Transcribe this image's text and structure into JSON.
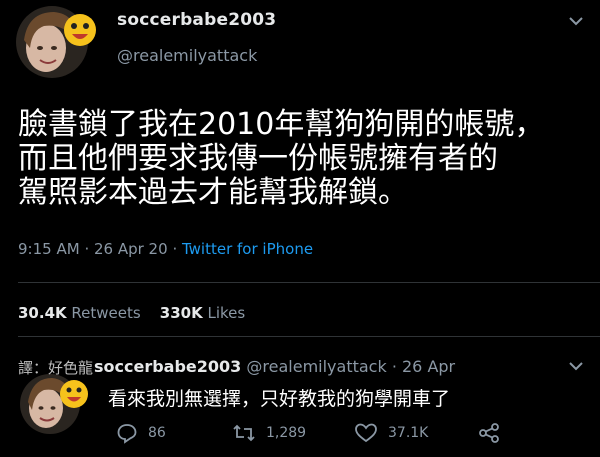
{
  "tweet": {
    "name": "soccerbabe2003",
    "handle": "@realemilyattack",
    "body_lines": [
      "臉書鎖了我在2010年幫狗狗開的帳號，",
      "而且他們要求我傳一份帳號擁有者的",
      "駕照影本過去才能幫我解鎖。"
    ],
    "time": "9:15 AM",
    "date": "26 Apr 20",
    "source": "Twitter for iPhone",
    "retweets_count": "30.4K",
    "retweets_label": "Retweets",
    "likes_count": "330K",
    "likes_label": "Likes"
  },
  "reply": {
    "translator_credit": "譯：好色龍",
    "name": "soccerbabe2003",
    "handle": "@realemilyattack",
    "date": "26 Apr",
    "text": "看來我別無選擇，只好教我的狗學開車了",
    "reply_count": "86",
    "retweet_count": "1,289",
    "like_count": "37.1K"
  },
  "icons": {
    "caret": "chevron-down-icon",
    "reply": "reply-icon",
    "retweet": "retweet-icon",
    "like": "heart-icon",
    "share": "share-icon"
  },
  "colors": {
    "background": "#000000",
    "text": "#e7e9ea",
    "muted": "#8b98a5",
    "link": "#1d9bf0"
  }
}
